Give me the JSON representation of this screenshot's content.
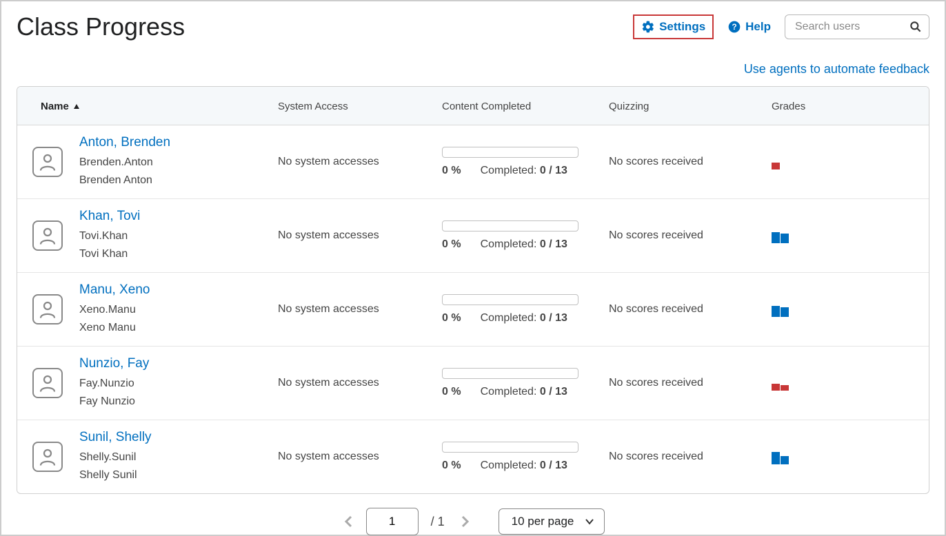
{
  "header": {
    "title": "Class Progress",
    "settings_label": "Settings",
    "help_label": "Help",
    "search_placeholder": "Search users",
    "agents_link": "Use agents to automate feedback"
  },
  "table": {
    "columns": {
      "name": "Name",
      "system_access": "System Access",
      "content_completed": "Content Completed",
      "quizzing": "Quizzing",
      "grades": "Grades"
    },
    "completed_label": "Completed:",
    "rows": [
      {
        "name": "Anton, Brenden",
        "username": "Brenden.Anton",
        "display_name": "Brenden Anton",
        "system_access": "No system accesses",
        "percent": "0 %",
        "completed": "0 / 13",
        "quizzing": "No scores received",
        "bars": [
          {
            "color": "red",
            "h": 10
          }
        ]
      },
      {
        "name": "Khan, Tovi",
        "username": "Tovi.Khan",
        "display_name": "Tovi Khan",
        "system_access": "No system accesses",
        "percent": "0 %",
        "completed": "0 / 13",
        "quizzing": "No scores received",
        "bars": [
          {
            "color": "blue",
            "h": 16
          },
          {
            "color": "blue",
            "h": 14
          }
        ]
      },
      {
        "name": "Manu, Xeno",
        "username": "Xeno.Manu",
        "display_name": "Xeno Manu",
        "system_access": "No system accesses",
        "percent": "0 %",
        "completed": "0 / 13",
        "quizzing": "No scores received",
        "bars": [
          {
            "color": "blue",
            "h": 16
          },
          {
            "color": "blue",
            "h": 14
          }
        ]
      },
      {
        "name": "Nunzio, Fay",
        "username": "Fay.Nunzio",
        "display_name": "Fay Nunzio",
        "system_access": "No system accesses",
        "percent": "0 %",
        "completed": "0 / 13",
        "quizzing": "No scores received",
        "bars": [
          {
            "color": "red",
            "h": 10
          },
          {
            "color": "red",
            "h": 8
          }
        ]
      },
      {
        "name": "Sunil, Shelly",
        "username": "Shelly.Sunil",
        "display_name": "Shelly Sunil",
        "system_access": "No system accesses",
        "percent": "0 %",
        "completed": "0 / 13",
        "quizzing": "No scores received",
        "bars": [
          {
            "color": "blue",
            "h": 18
          },
          {
            "color": "blue",
            "h": 12
          }
        ]
      }
    ]
  },
  "pagination": {
    "current": "1",
    "total": "/  1",
    "per_page_label": "10 per page"
  }
}
